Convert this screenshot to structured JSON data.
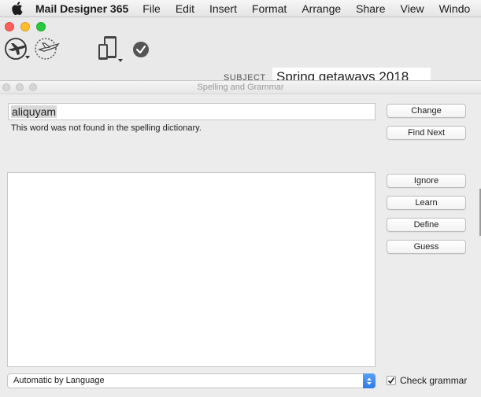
{
  "menubar": {
    "app_name": "Mail Designer 365",
    "items": [
      "File",
      "Edit",
      "Insert",
      "Format",
      "Arrange",
      "Share",
      "View",
      "Windo"
    ]
  },
  "app_window": {
    "subject_label": "SUBJECT",
    "subject_value": "Spring getaways 2018"
  },
  "spelling_panel": {
    "title": "Spelling and Grammar",
    "word": "aliquyam",
    "status": "This word was not found in the spelling dictionary.",
    "buttons": {
      "change": "Change",
      "find_next": "Find Next",
      "ignore": "Ignore",
      "learn": "Learn",
      "define": "Define",
      "guess": "Guess"
    },
    "language": "Automatic by Language",
    "check_grammar_label": "Check grammar",
    "check_grammar_checked": true
  },
  "colors": {
    "close": "#fc5f57",
    "minimize": "#fdbd2e",
    "maximize": "#28c940",
    "select_accent": "#2f7be6"
  }
}
